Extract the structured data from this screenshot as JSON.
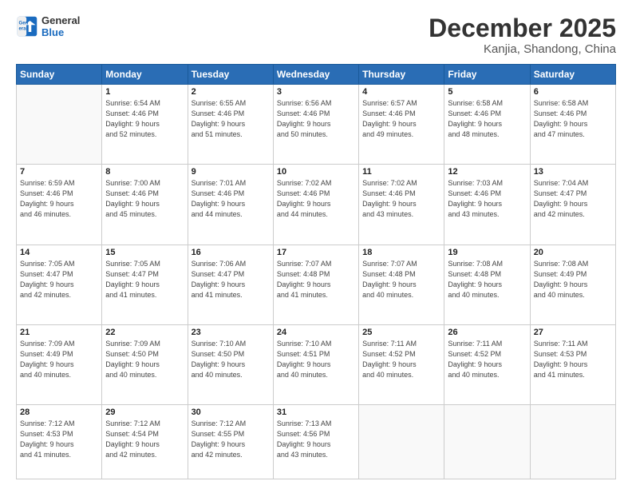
{
  "header": {
    "logo_line1": "General",
    "logo_line2": "Blue",
    "month": "December 2025",
    "location": "Kanjia, Shandong, China"
  },
  "days_of_week": [
    "Sunday",
    "Monday",
    "Tuesday",
    "Wednesday",
    "Thursday",
    "Friday",
    "Saturday"
  ],
  "weeks": [
    [
      {
        "day": "",
        "info": ""
      },
      {
        "day": "1",
        "info": "Sunrise: 6:54 AM\nSunset: 4:46 PM\nDaylight: 9 hours\nand 52 minutes."
      },
      {
        "day": "2",
        "info": "Sunrise: 6:55 AM\nSunset: 4:46 PM\nDaylight: 9 hours\nand 51 minutes."
      },
      {
        "day": "3",
        "info": "Sunrise: 6:56 AM\nSunset: 4:46 PM\nDaylight: 9 hours\nand 50 minutes."
      },
      {
        "day": "4",
        "info": "Sunrise: 6:57 AM\nSunset: 4:46 PM\nDaylight: 9 hours\nand 49 minutes."
      },
      {
        "day": "5",
        "info": "Sunrise: 6:58 AM\nSunset: 4:46 PM\nDaylight: 9 hours\nand 48 minutes."
      },
      {
        "day": "6",
        "info": "Sunrise: 6:58 AM\nSunset: 4:46 PM\nDaylight: 9 hours\nand 47 minutes."
      }
    ],
    [
      {
        "day": "7",
        "info": "Sunrise: 6:59 AM\nSunset: 4:46 PM\nDaylight: 9 hours\nand 46 minutes."
      },
      {
        "day": "8",
        "info": "Sunrise: 7:00 AM\nSunset: 4:46 PM\nDaylight: 9 hours\nand 45 minutes."
      },
      {
        "day": "9",
        "info": "Sunrise: 7:01 AM\nSunset: 4:46 PM\nDaylight: 9 hours\nand 44 minutes."
      },
      {
        "day": "10",
        "info": "Sunrise: 7:02 AM\nSunset: 4:46 PM\nDaylight: 9 hours\nand 44 minutes."
      },
      {
        "day": "11",
        "info": "Sunrise: 7:02 AM\nSunset: 4:46 PM\nDaylight: 9 hours\nand 43 minutes."
      },
      {
        "day": "12",
        "info": "Sunrise: 7:03 AM\nSunset: 4:46 PM\nDaylight: 9 hours\nand 43 minutes."
      },
      {
        "day": "13",
        "info": "Sunrise: 7:04 AM\nSunset: 4:47 PM\nDaylight: 9 hours\nand 42 minutes."
      }
    ],
    [
      {
        "day": "14",
        "info": "Sunrise: 7:05 AM\nSunset: 4:47 PM\nDaylight: 9 hours\nand 42 minutes."
      },
      {
        "day": "15",
        "info": "Sunrise: 7:05 AM\nSunset: 4:47 PM\nDaylight: 9 hours\nand 41 minutes."
      },
      {
        "day": "16",
        "info": "Sunrise: 7:06 AM\nSunset: 4:47 PM\nDaylight: 9 hours\nand 41 minutes."
      },
      {
        "day": "17",
        "info": "Sunrise: 7:07 AM\nSunset: 4:48 PM\nDaylight: 9 hours\nand 41 minutes."
      },
      {
        "day": "18",
        "info": "Sunrise: 7:07 AM\nSunset: 4:48 PM\nDaylight: 9 hours\nand 40 minutes."
      },
      {
        "day": "19",
        "info": "Sunrise: 7:08 AM\nSunset: 4:48 PM\nDaylight: 9 hours\nand 40 minutes."
      },
      {
        "day": "20",
        "info": "Sunrise: 7:08 AM\nSunset: 4:49 PM\nDaylight: 9 hours\nand 40 minutes."
      }
    ],
    [
      {
        "day": "21",
        "info": "Sunrise: 7:09 AM\nSunset: 4:49 PM\nDaylight: 9 hours\nand 40 minutes."
      },
      {
        "day": "22",
        "info": "Sunrise: 7:09 AM\nSunset: 4:50 PM\nDaylight: 9 hours\nand 40 minutes."
      },
      {
        "day": "23",
        "info": "Sunrise: 7:10 AM\nSunset: 4:50 PM\nDaylight: 9 hours\nand 40 minutes."
      },
      {
        "day": "24",
        "info": "Sunrise: 7:10 AM\nSunset: 4:51 PM\nDaylight: 9 hours\nand 40 minutes."
      },
      {
        "day": "25",
        "info": "Sunrise: 7:11 AM\nSunset: 4:52 PM\nDaylight: 9 hours\nand 40 minutes."
      },
      {
        "day": "26",
        "info": "Sunrise: 7:11 AM\nSunset: 4:52 PM\nDaylight: 9 hours\nand 40 minutes."
      },
      {
        "day": "27",
        "info": "Sunrise: 7:11 AM\nSunset: 4:53 PM\nDaylight: 9 hours\nand 41 minutes."
      }
    ],
    [
      {
        "day": "28",
        "info": "Sunrise: 7:12 AM\nSunset: 4:53 PM\nDaylight: 9 hours\nand 41 minutes."
      },
      {
        "day": "29",
        "info": "Sunrise: 7:12 AM\nSunset: 4:54 PM\nDaylight: 9 hours\nand 42 minutes."
      },
      {
        "day": "30",
        "info": "Sunrise: 7:12 AM\nSunset: 4:55 PM\nDaylight: 9 hours\nand 42 minutes."
      },
      {
        "day": "31",
        "info": "Sunrise: 7:13 AM\nSunset: 4:56 PM\nDaylight: 9 hours\nand 43 minutes."
      },
      {
        "day": "",
        "info": ""
      },
      {
        "day": "",
        "info": ""
      },
      {
        "day": "",
        "info": ""
      }
    ]
  ]
}
